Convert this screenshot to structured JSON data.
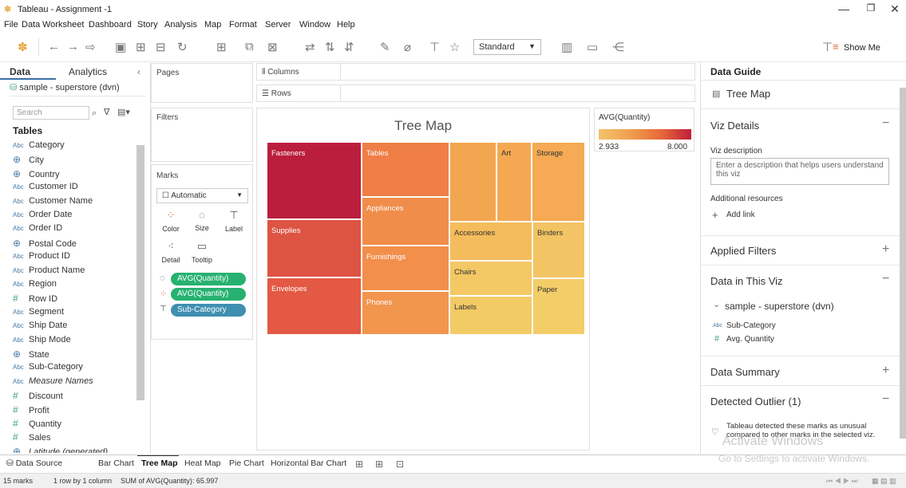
{
  "app": {
    "title": "Tableau - Assignment -1",
    "min": "—",
    "max": "❐",
    "close": "✕"
  },
  "menu": [
    "File",
    "Data",
    "Worksheet",
    "Dashboard",
    "Story",
    "Analysis",
    "Map",
    "Format",
    "Server",
    "Window",
    "Help"
  ],
  "toolbar": {
    "standard": "Standard",
    "show_me": "Show Me"
  },
  "left": {
    "tab_data": "Data",
    "tab_analytics": "Analytics",
    "datasource": "sample - superstore (dvn)",
    "search_placeholder": "Search",
    "tables_heading": "Tables",
    "fields": [
      {
        "type": "Abc",
        "name": "Category"
      },
      {
        "type": "geo",
        "name": "City"
      },
      {
        "type": "geo",
        "name": "Country"
      },
      {
        "type": "Abc",
        "name": "Customer ID"
      },
      {
        "type": "Abc",
        "name": "Customer Name"
      },
      {
        "type": "Abc",
        "name": "Order Date"
      },
      {
        "type": "Abc",
        "name": "Order ID"
      },
      {
        "type": "geo",
        "name": "Postal Code"
      },
      {
        "type": "Abc",
        "name": "Product ID"
      },
      {
        "type": "Abc",
        "name": "Product Name"
      },
      {
        "type": "Abc",
        "name": "Region"
      },
      {
        "type": "#",
        "name": "Row ID"
      },
      {
        "type": "Abc",
        "name": "Segment"
      },
      {
        "type": "Abc",
        "name": "Ship Date"
      },
      {
        "type": "Abc",
        "name": "Ship Mode"
      },
      {
        "type": "geo",
        "name": "State"
      },
      {
        "type": "Abc",
        "name": "Sub-Category"
      },
      {
        "type": "Abc",
        "name": "Measure Names"
      },
      {
        "type": "#",
        "name": "Discount"
      },
      {
        "type": "#",
        "name": "Profit"
      },
      {
        "type": "#",
        "name": "Quantity"
      },
      {
        "type": "#",
        "name": "Sales"
      },
      {
        "type": "geo",
        "name": "Latitude (generated)"
      }
    ]
  },
  "shelves": {
    "pages": "Pages",
    "filters": "Filters",
    "marks": "Marks",
    "mark_type": "Automatic",
    "columns": "Columns",
    "rows": "Rows",
    "mark_buttons": [
      "Color",
      "Size",
      "Label",
      "Detail",
      "Tooltip"
    ],
    "pills": [
      "AVG(Quantity)",
      "AVG(Quantity)",
      "Sub-Category"
    ]
  },
  "viz": {
    "title": "Tree Map"
  },
  "chart_data": {
    "type": "treemap",
    "title": "Tree Map",
    "measure": "AVG(Quantity)",
    "items": [
      {
        "label": "Fasteners",
        "color": "#bb1d3d"
      },
      {
        "label": "Supplies",
        "color": "#dd5443"
      },
      {
        "label": "Envelopes",
        "color": "#e35944"
      },
      {
        "label": "Tables",
        "color": "#ef7e47"
      },
      {
        "label": "Appliances",
        "color": "#f08d4a"
      },
      {
        "label": "Furnishings",
        "color": "#f18f4b"
      },
      {
        "label": "Phones",
        "color": "#f2954d"
      },
      {
        "label": "Art",
        "color": "#f5a852"
      },
      {
        "label": "Storage",
        "color": "#f5aa53"
      },
      {
        "label": "Accessories",
        "color": "#f4bc5c"
      },
      {
        "label": "Binders",
        "color": "#f3c464"
      },
      {
        "label": "Chairs",
        "color": "#f3c865"
      },
      {
        "label": "Paper",
        "color": "#f3cd68"
      },
      {
        "label": "Labels",
        "color": "#f3cb66"
      }
    ]
  },
  "legend": {
    "title": "AVG(Quantity)",
    "min": "2.933",
    "max": "8.000"
  },
  "right": {
    "title": "Data Guide",
    "viz_name": "Tree Map",
    "viz_details": "Viz Details",
    "viz_desc_label": "Viz description",
    "viz_desc_placeholder": "Enter a description that helps users understand this viz",
    "additional_resources": "Additional resources",
    "add_link": "Add link",
    "applied_filters": "Applied Filters",
    "data_in_viz": "Data in This Viz",
    "ds": "sample - superstore (dvn)",
    "f1": "Sub-Category",
    "f2": "Avg. Quantity",
    "data_summary": "Data Summary",
    "outlier": "Detected Outlier (1)",
    "outlier_text": "Tableau detected these marks as unusual compared to other marks in the selected viz."
  },
  "tabs": [
    "Data Source",
    "Bar Chart",
    "Tree Map",
    "Heat Map",
    "Pie Chart",
    "Horizontal Bar Chart"
  ],
  "status": {
    "marks": "15 marks",
    "rows": "1 row by 1 column",
    "sum": "SUM of AVG(Quantity): 65.997"
  },
  "watermark": {
    "l1": "Activate Windows",
    "l2": "Go to Settings to activate Windows."
  }
}
